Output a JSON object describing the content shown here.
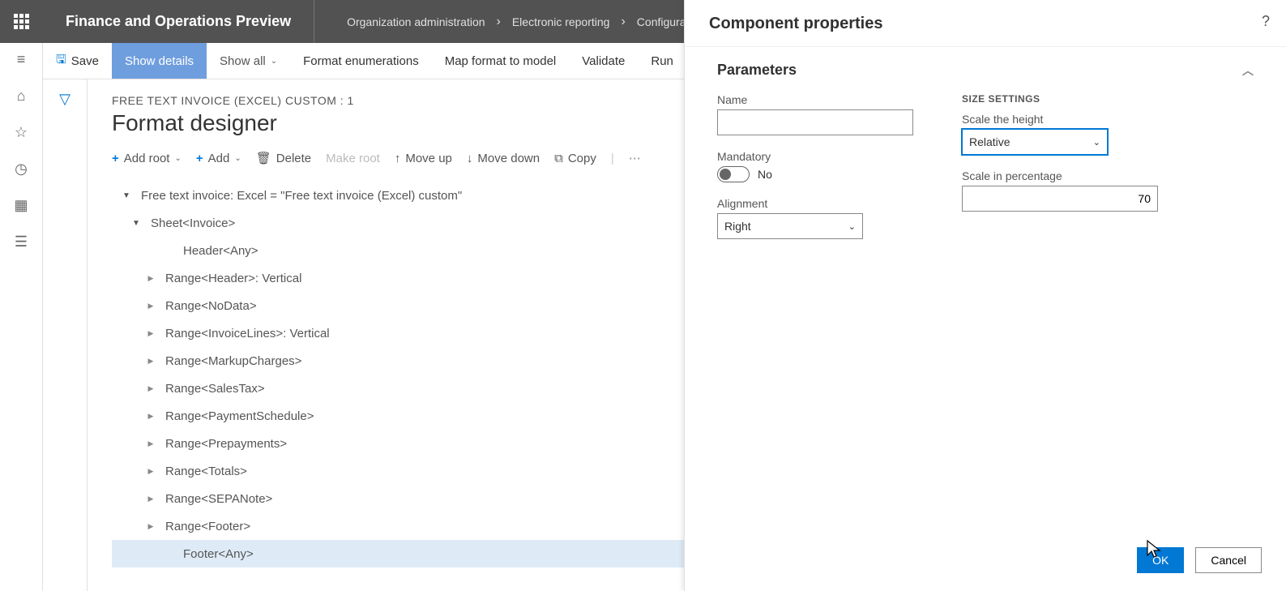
{
  "header": {
    "app_title": "Finance and Operations Preview",
    "breadcrumbs": [
      "Organization administration",
      "Electronic reporting",
      "Configurations"
    ]
  },
  "cmdbar": {
    "save": "Save",
    "show_details": "Show details",
    "show_all": "Show all",
    "format_enum": "Format enumerations",
    "map_format": "Map format to model",
    "validate": "Validate",
    "run": "Run"
  },
  "page": {
    "config_path": "FREE TEXT INVOICE (EXCEL) CUSTOM : 1",
    "title": "Format designer"
  },
  "toolbar": {
    "add_root": "Add root",
    "add": "Add",
    "delete": "Delete",
    "make_root": "Make root",
    "move_up": "Move up",
    "move_down": "Move down",
    "copy": "Copy"
  },
  "tree": {
    "root": "Free text invoice: Excel = \"Free text invoice (Excel) custom\"",
    "sheet": "Sheet<Invoice>",
    "items": [
      "Header<Any>",
      "Range<Header>: Vertical",
      "Range<NoData>",
      "Range<InvoiceLines>: Vertical",
      "Range<MarkupCharges>",
      "Range<SalesTax>",
      "Range<PaymentSchedule>",
      "Range<Prepayments>",
      "Range<Totals>",
      "Range<SEPANote>",
      "Range<Footer>",
      "Footer<Any>"
    ]
  },
  "panel": {
    "title": "Component properties",
    "section": "Parameters",
    "name_label": "Name",
    "name_value": "",
    "mandatory_label": "Mandatory",
    "mandatory_value": "No",
    "alignment_label": "Alignment",
    "alignment_value": "Right",
    "size_group": "SIZE SETTINGS",
    "scale_height_label": "Scale the height",
    "scale_height_value": "Relative",
    "scale_pct_label": "Scale in percentage",
    "scale_pct_value": "70",
    "ok": "OK",
    "cancel": "Cancel"
  }
}
